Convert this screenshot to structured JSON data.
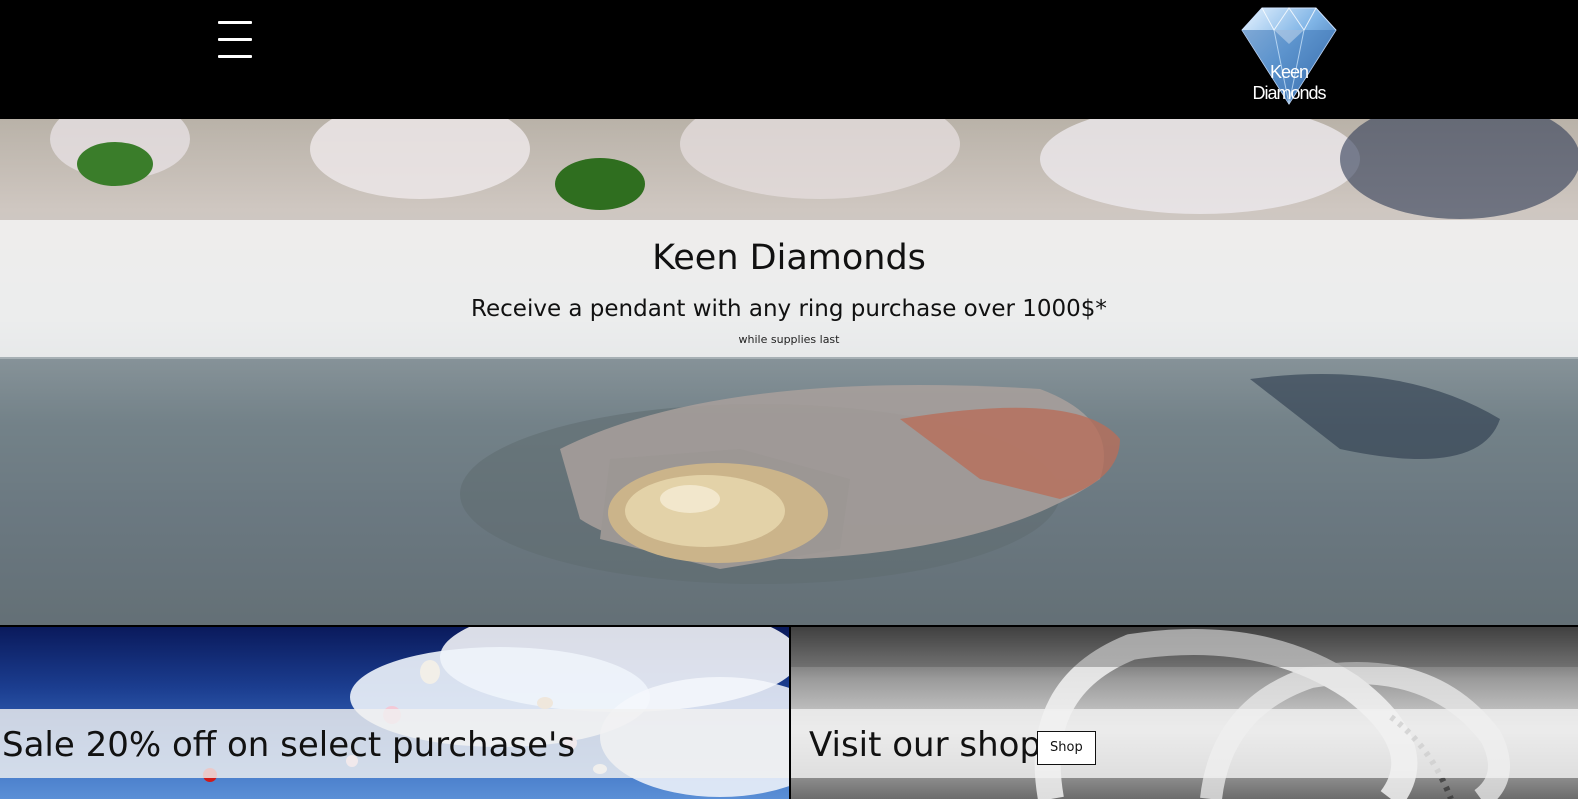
{
  "header": {
    "menu_icon": "hamburger-menu-icon",
    "logo_text": "Keen Diamonds"
  },
  "hero": {
    "title": "Keen Diamonds",
    "subtitle": "Receive a pendant with any ring purchase over 1000$*",
    "note": "while supplies last"
  },
  "promos": {
    "sale": {
      "title": "Sale 20% off on select purchase's"
    },
    "shop": {
      "title": "Visit our shop",
      "button_label": "Shop"
    }
  },
  "colors": {
    "header_bg": "#000000",
    "band_bg": "#f5f5f5"
  }
}
